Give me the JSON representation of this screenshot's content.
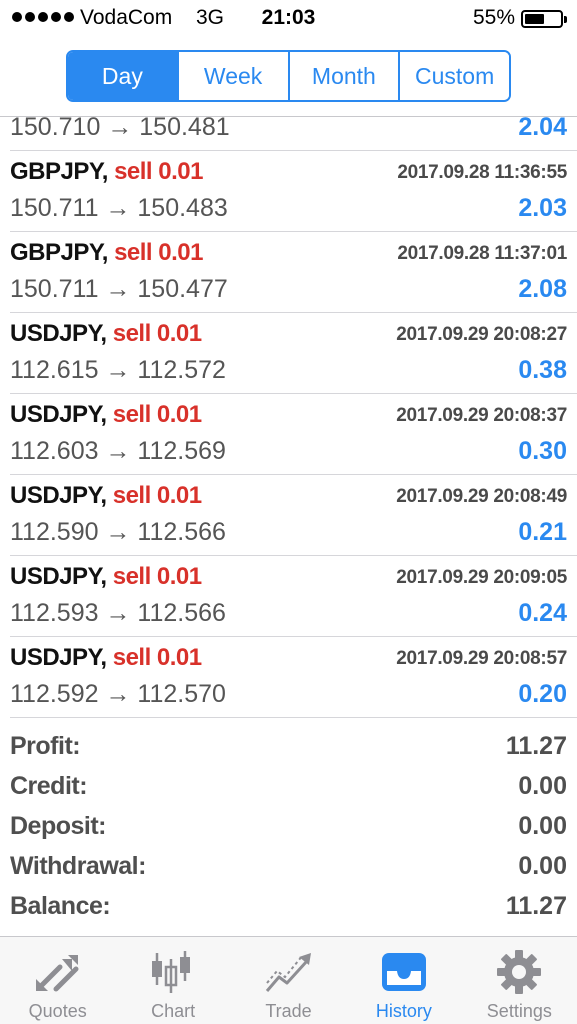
{
  "status_bar": {
    "carrier": "VodaCom",
    "network": "3G",
    "time": "21:03",
    "battery_percent": "55%",
    "battery_level": 0.55
  },
  "segments": {
    "items": [
      "Day",
      "Week",
      "Month",
      "Custom"
    ],
    "selected": "Day"
  },
  "trades": [
    {
      "symbol": "",
      "action": "",
      "time": "",
      "prices": "150.710 → 150.481",
      "profit": "2.04"
    },
    {
      "symbol": "GBPJPY,",
      "action": "sell 0.01",
      "time": "2017.09.28 11:36:55",
      "prices": "150.711 → 150.483",
      "profit": "2.03"
    },
    {
      "symbol": "GBPJPY,",
      "action": "sell 0.01",
      "time": "2017.09.28 11:37:01",
      "prices": "150.711 → 150.477",
      "profit": "2.08"
    },
    {
      "symbol": "USDJPY,",
      "action": "sell 0.01",
      "time": "2017.09.29 20:08:27",
      "prices": "112.615 → 112.572",
      "profit": "0.38"
    },
    {
      "symbol": "USDJPY,",
      "action": "sell 0.01",
      "time": "2017.09.29 20:08:37",
      "prices": "112.603 → 112.569",
      "profit": "0.30"
    },
    {
      "symbol": "USDJPY,",
      "action": "sell 0.01",
      "time": "2017.09.29 20:08:49",
      "prices": "112.590 → 112.566",
      "profit": "0.21"
    },
    {
      "symbol": "USDJPY,",
      "action": "sell 0.01",
      "time": "2017.09.29 20:09:05",
      "prices": "112.593 → 112.566",
      "profit": "0.24"
    },
    {
      "symbol": "USDJPY,",
      "action": "sell 0.01",
      "time": "2017.09.29 20:08:57",
      "prices": "112.592 → 112.570",
      "profit": "0.20"
    }
  ],
  "summary": {
    "profit_label": "Profit:",
    "profit": "11.27",
    "credit_label": "Credit:",
    "credit": "0.00",
    "deposit_label": "Deposit:",
    "deposit": "0.00",
    "withdrawal_label": "Withdrawal:",
    "withdrawal": "0.00",
    "balance_label": "Balance:",
    "balance": "11.27"
  },
  "tabs": [
    {
      "label": "Quotes",
      "icon": "quotes-arrows-icon"
    },
    {
      "label": "Chart",
      "icon": "candlestick-chart-icon"
    },
    {
      "label": "Trade",
      "icon": "trade-line-icon"
    },
    {
      "label": "History",
      "icon": "history-inbox-icon"
    },
    {
      "label": "Settings",
      "icon": "gear-icon"
    }
  ],
  "active_tab": "History",
  "colors": {
    "accent": "#2a89f0",
    "sell": "#d8312a",
    "tab_inactive": "#8e8e93"
  }
}
